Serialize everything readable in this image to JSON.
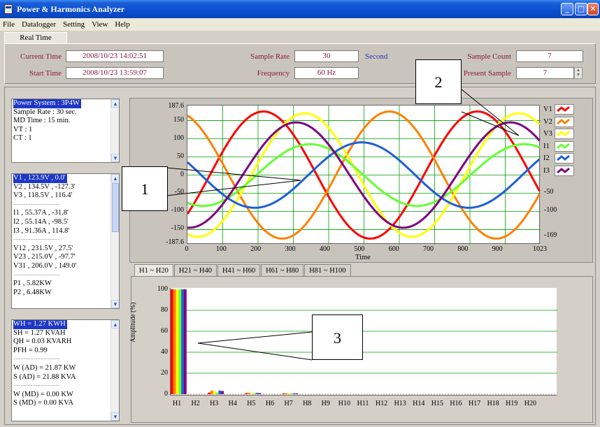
{
  "window": {
    "title": "Power & Harmonics Analyzer"
  },
  "menu": [
    "File",
    "Datalogger",
    "Setting",
    "View",
    "Help"
  ],
  "tab": "Real Time",
  "info": {
    "current_time_label": "Current Time",
    "current_time": "2008/10/23 14:02:51",
    "start_time_label": "Start Time",
    "start_time": "2008/10/23 13:59:07",
    "sample_rate_label": "Sample Rate",
    "sample_rate": "30",
    "sample_rate_unit": "Second",
    "frequency_label": "Frequency",
    "frequency": "60 Hz",
    "sample_count_label": "Sample Count",
    "sample_count": "7",
    "present_sample_label": "Present Sample",
    "present_sample": "7"
  },
  "system_list": [
    "Power System : 3P4W",
    "Sample Rate : 30 sec.",
    "MD Time : 15 min.",
    "VT : 1",
    "CT : 1"
  ],
  "measure_list": [
    "V1 , 123.9V , 0.0'",
    "V2 , 134.5V , -127.3'",
    "V3 , 118.5V , 116.4'",
    "-------------------",
    "I1 , 55.37A , -31.8'",
    "I2 , 55.14A , -98.5'",
    "I3 , 91.36A , 114.8'",
    "-------------------",
    "V12 , 231.5V , 27.5'",
    "V23 , 215.0V , -97.7'",
    "V31 , 206.0V , 149.0'",
    "-------------------",
    "P1 , 5.82KW",
    "P2 , 6.48KW"
  ],
  "energy_list": [
    "WH = 1.27 KWH",
    "SH = 1.27 KVAH",
    "QH = 0.03 KVARH",
    "PFH = 0.99",
    "-------------------",
    "W (AD) = 21.87 KW",
    "S (AD) = 21.88 KVA",
    "-------------------",
    "W (MD) = 0.00 KW",
    "S (MD) = 0.00 KVA"
  ],
  "waveform": {
    "y_ticks": [
      "187.6",
      "150",
      "100",
      "50",
      "0",
      "-50",
      "-100",
      "-150",
      "-187.6"
    ],
    "y_right_ticks": [
      "-50",
      "-100",
      "-169"
    ],
    "x_ticks": [
      "0",
      "100",
      "200",
      "300",
      "400",
      "500",
      "600",
      "700",
      "800",
      "900",
      "1023"
    ],
    "xlabel": "Time",
    "legend": [
      {
        "name": "V1",
        "color": "#ff0000"
      },
      {
        "name": "V2",
        "color": "#ff8000"
      },
      {
        "name": "V3",
        "color": "#ffff00"
      },
      {
        "name": "I1",
        "color": "#66ff33"
      },
      {
        "name": "I2",
        "color": "#1e5fd6"
      },
      {
        "name": "I3",
        "color": "#800080"
      }
    ]
  },
  "harmonic_tabs": [
    "H1 ~ H20",
    "H21 ~ H40",
    "H41 ~ H60",
    "H61 ~ H80",
    "H81 ~ H100"
  ],
  "harmonic": {
    "ylabel": "Amplitude (%)",
    "y_ticks": [
      "100",
      "80",
      "60",
      "40",
      "20",
      "0"
    ],
    "x_ticks": [
      "H1",
      "H2",
      "H3",
      "H4",
      "H5",
      "H6",
      "H7",
      "H8",
      "H9",
      "H10",
      "H11",
      "H12",
      "H13",
      "H14",
      "H15",
      "H16",
      "H17",
      "H18",
      "H19",
      "H20"
    ]
  },
  "callouts": [
    "1",
    "2",
    "3"
  ],
  "colors": {
    "title_bar": "#0a4ed0",
    "label": "#8b1a3b",
    "unit": "#2a3ab5",
    "grid": "#00a000",
    "selection": "#1e37c6"
  }
}
